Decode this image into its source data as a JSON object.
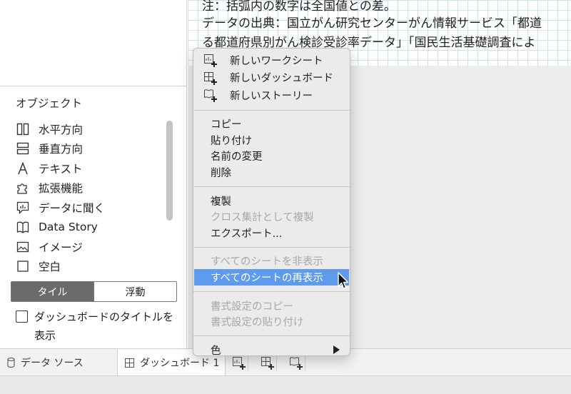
{
  "canvas_text": {
    "line1": "注：括弧内の数字は全国値との差。",
    "line2": "データの出典：国立がん研究センターがん情報サービス「都道",
    "line3": "る都道府県別がん検診受診率データ」「国民生活基礎調査によ"
  },
  "objects": {
    "title": "オブジェクト",
    "items": [
      {
        "label": "水平方向",
        "icon": "horizontal-layout-icon"
      },
      {
        "label": "垂直方向",
        "icon": "vertical-layout-icon"
      },
      {
        "label": "テキスト",
        "icon": "text-icon"
      },
      {
        "label": "拡張機能",
        "icon": "extension-puzzle-icon"
      },
      {
        "label": "データに聞く",
        "icon": "ask-data-icon"
      },
      {
        "label": "Data Story",
        "icon": "data-story-book-icon"
      },
      {
        "label": "イメージ",
        "icon": "image-icon"
      },
      {
        "label": "空白",
        "icon": "blank-icon"
      }
    ],
    "tiled_label": "タイル",
    "floating_label": "浮動",
    "show_title_line1": "ダッシュボードのタイトルを",
    "show_title_line2": "表示"
  },
  "tabs": {
    "data_source": "データ ソース",
    "dashboard": "ダッシュボード 1"
  },
  "menu": {
    "new_worksheet": "新しいワークシート",
    "new_dashboard": "新しいダッシュボード",
    "new_story": "新しいストーリー",
    "copy": "コピー",
    "paste": "貼り付け",
    "rename": "名前の変更",
    "delete": "削除",
    "duplicate": "複製",
    "duplicate_crosstab": "クロス集計として複製",
    "export": "エクスポート...",
    "hide_all_sheets": "すべてのシートを非表示",
    "unhide_all_sheets": "すべてのシートの再表示",
    "copy_formatting": "書式設定のコピー",
    "paste_formatting": "書式設定の貼り付け",
    "color": "色"
  },
  "colors": {
    "highlight": "#5f9bec",
    "selected_segment": "#6b6b6b"
  }
}
